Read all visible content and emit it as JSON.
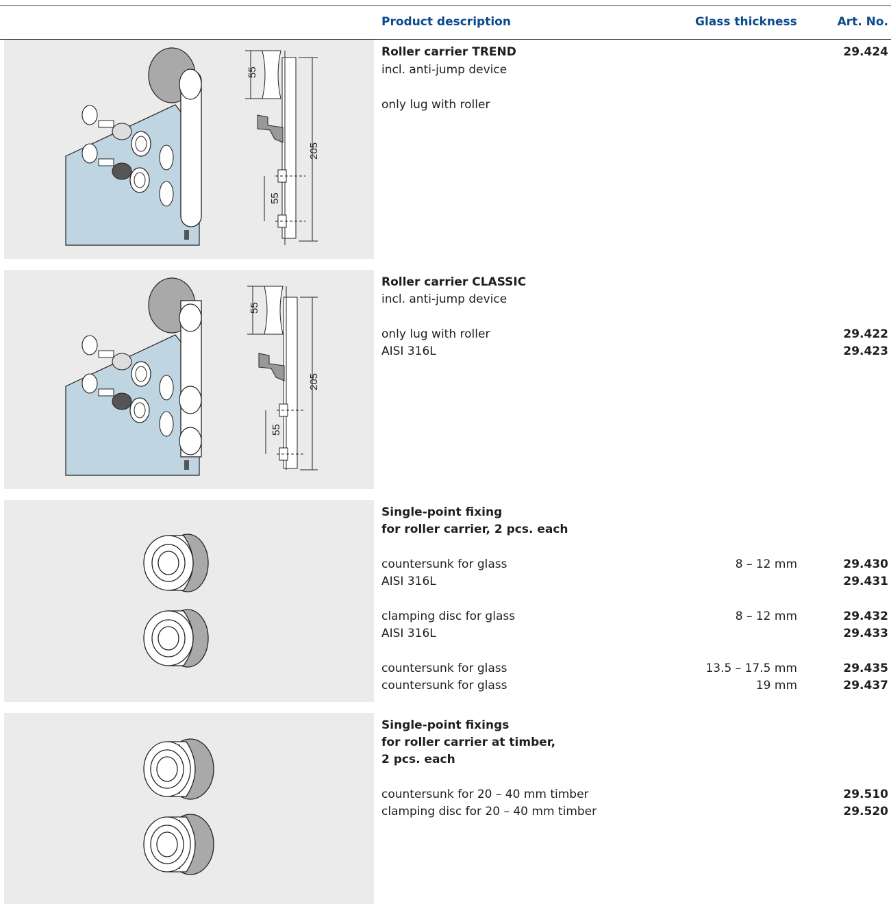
{
  "header": {
    "description": "Product description",
    "glass": "Glass thickness",
    "art": "Art. No."
  },
  "dims": {
    "d55": "55",
    "d205": "205"
  },
  "sections": {
    "trend": {
      "title": "Roller carrier TREND",
      "sub": "incl. anti-jump device",
      "art_main": "29.424",
      "row1": {
        "desc": "only lug with roller"
      }
    },
    "classic": {
      "title": "Roller carrier CLASSIC",
      "sub": "incl. anti-jump device",
      "row1": {
        "desc": "only lug with roller",
        "art": "29.422"
      },
      "row2": {
        "desc": "AISI 316L",
        "art": "29.423"
      }
    },
    "spf": {
      "title1": "Single-point fixing",
      "title2": "for roller carrier, 2 pcs. each",
      "r1": {
        "desc": "countersunk for glass",
        "glass": "8 – 12 mm",
        "art": "29.430"
      },
      "r2": {
        "desc": "AISI 316L",
        "art": "29.431"
      },
      "r3": {
        "desc": "clamping disc for glass",
        "glass": "8 – 12 mm",
        "art": "29.432"
      },
      "r4": {
        "desc": "AISI 316L",
        "art": "29.433"
      },
      "r5": {
        "desc": "countersunk for glass",
        "glass": "13.5 – 17.5 mm",
        "art": "29.435"
      },
      "r6": {
        "desc": "countersunk for glass",
        "glass": "19 mm",
        "art": "29.437"
      }
    },
    "timber": {
      "title1": "Single-point fixings",
      "title2": "for roller carrier at timber,",
      "title3": "2 pcs. each",
      "r1": {
        "desc": "countersunk for 20 – 40 mm timber",
        "art": "29.510"
      },
      "r2": {
        "desc": "clamping disc for 20 – 40 mm timber",
        "art": "29.520"
      }
    }
  },
  "colors": {
    "accent": "#0b4a8c",
    "image_bg": "#ebebeb",
    "glass": "#bfd6e2"
  }
}
